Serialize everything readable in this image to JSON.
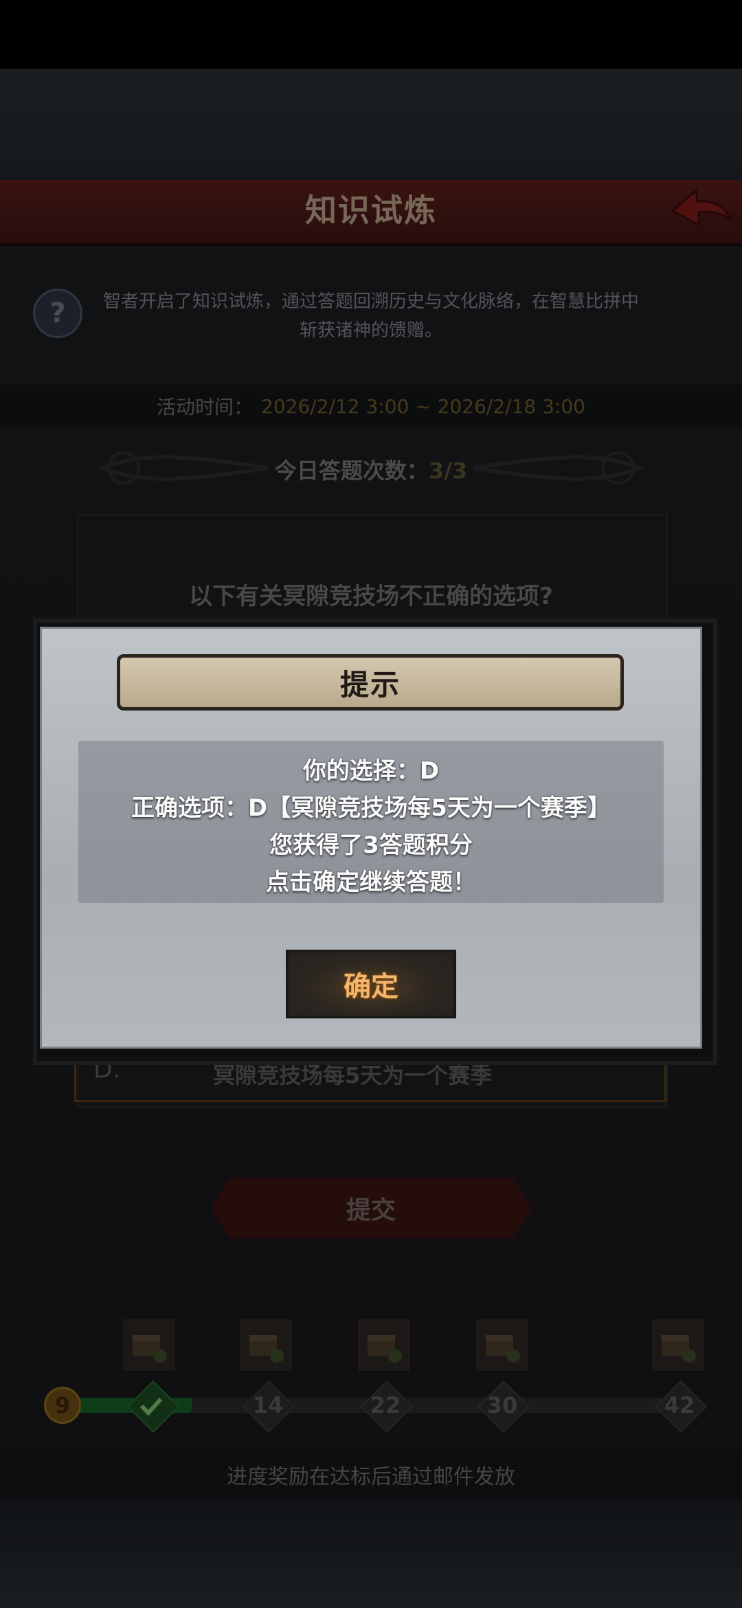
{
  "header": {
    "title": "知识试炼"
  },
  "intro": {
    "line1": "智者开启了知识试炼，通过答题回溯历史与文化脉络，在智慧比拼中",
    "line2": "斩获诸神的馈赠。"
  },
  "event_time": {
    "label": "活动时间：",
    "value": "2026/2/12 3:00 ~ 2026/2/18 3:00"
  },
  "daily": {
    "label": "今日答题次数：",
    "value": "3/3"
  },
  "question": {
    "text": "以下有关冥隙竞技场不正确的选项?"
  },
  "option_d": {
    "letter": "D.",
    "text": "冥隙竞技场每5天为一个赛季"
  },
  "submit_label": "提交",
  "progress": {
    "current_level": "9",
    "fill_fraction": 0.205,
    "milestones": [
      "14",
      "22",
      "30",
      "42"
    ]
  },
  "footer": {
    "note": "进度奖励在达标后通过邮件发放"
  },
  "dialog": {
    "title": "提示",
    "lines": [
      "你的选择：D",
      "正确选项：D【冥隙竞技场每5天为一个赛季】",
      "您获得了3答题积分",
      "点击确定继续答题！"
    ],
    "confirm_label": "确定"
  },
  "icons": {
    "back": "back-arrow-icon",
    "help": "question-mark-icon",
    "reward": "treasure-chest-icon",
    "check": "checkmark-icon"
  },
  "colors": {
    "header_red": "#5a1e1a",
    "progress_green": "#175d26",
    "confirm_text": "#f3b66a"
  }
}
